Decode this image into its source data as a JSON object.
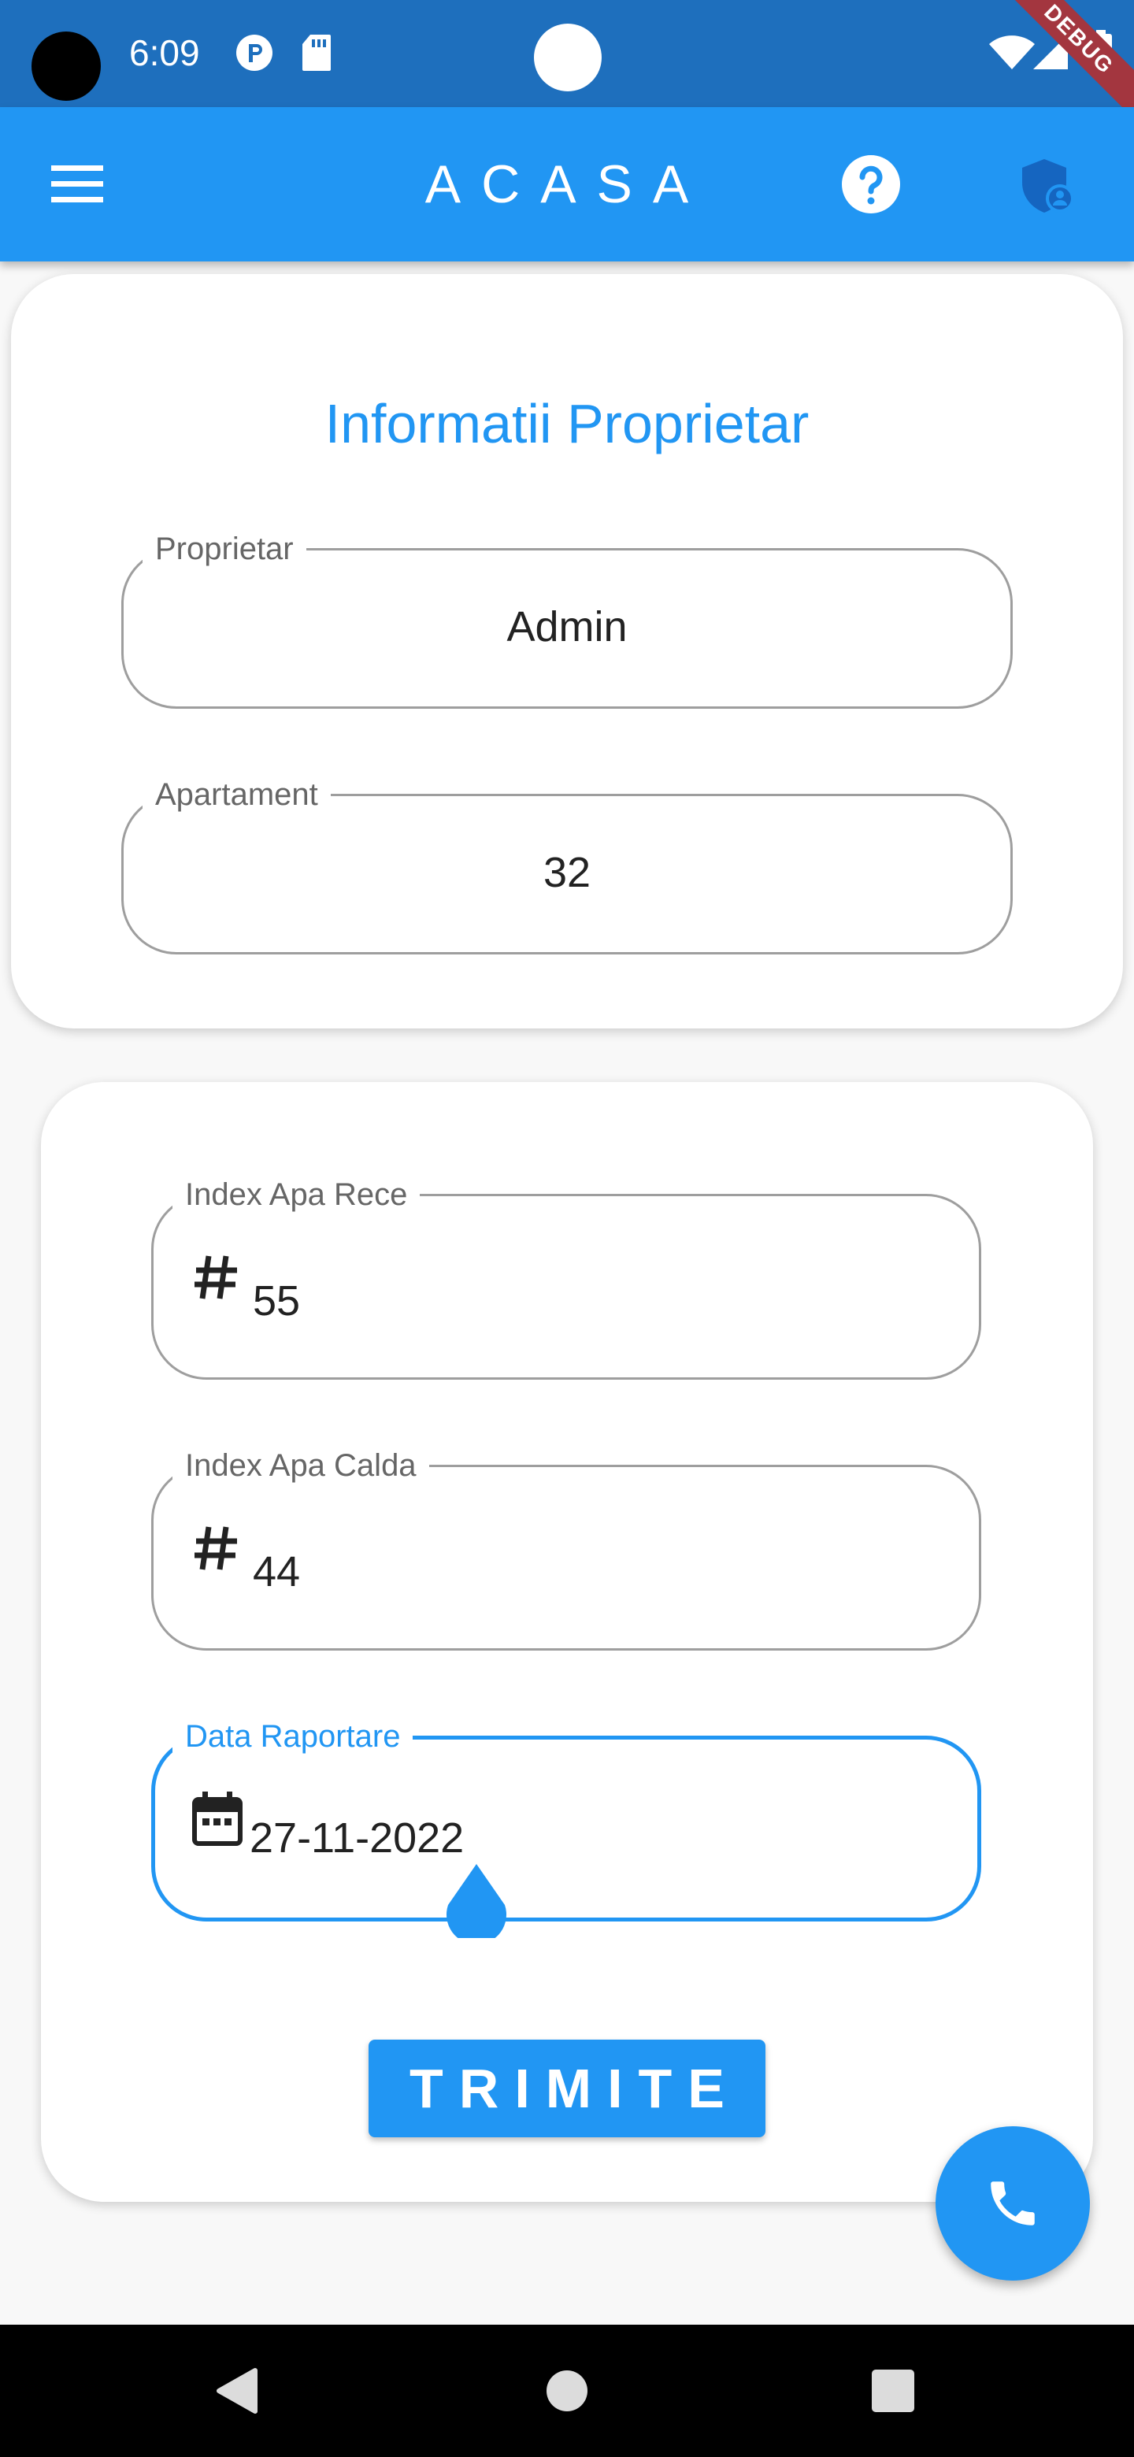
{
  "status_bar": {
    "time": "6:09",
    "debug_label": "DEBUG"
  },
  "app_bar": {
    "menu_icon": "menu-icon",
    "title": "ACASA",
    "help_icon": "help-circle-icon",
    "admin_icon": "shield-user-icon"
  },
  "owner_card": {
    "title": "Informatii Proprietar",
    "owner": {
      "label": "Proprietar",
      "value": "Admin"
    },
    "apartment": {
      "label": "Apartament",
      "value": "32"
    }
  },
  "reading_card": {
    "cold_water": {
      "label": "Index Apa Rece",
      "prefix_icon": "hash-icon",
      "value": "55"
    },
    "hot_water": {
      "label": "Index Apa Calda",
      "prefix_icon": "hash-icon",
      "value": "44"
    },
    "report_date": {
      "label": "Data Raportare",
      "prefix_icon": "calendar-icon",
      "value": "27-11-2022"
    },
    "submit_label": "TRIMITE"
  },
  "fab": {
    "icon": "phone-icon"
  },
  "nav_bar": {
    "back_icon": "back-triangle-icon",
    "home_icon": "home-circle-icon",
    "recents_icon": "recents-square-icon"
  },
  "colors": {
    "primary": "#2196f3",
    "status_bar": "#1e6fbd",
    "debug": "#a3363f"
  }
}
